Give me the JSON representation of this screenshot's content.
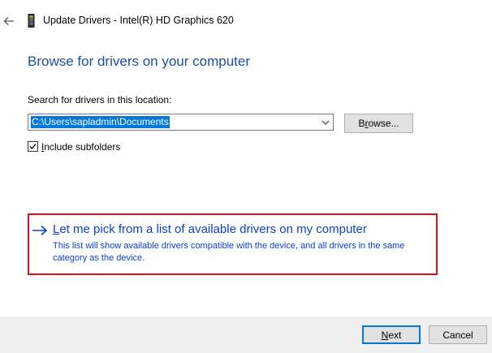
{
  "window": {
    "title": "Update Drivers - Intel(R) HD Graphics 620"
  },
  "page": {
    "heading": "Browse for drivers on your computer",
    "search_label": "Search for drivers in this location:",
    "path_value": "C:\\Users\\sapladmin\\Documents",
    "browse_label_pre": "B",
    "browse_label_accel": "r",
    "browse_label_post": "owse...",
    "include_subfolders_accel": "I",
    "include_subfolders_rest": "nclude subfolders",
    "include_subfolders_checked": true
  },
  "pick_option": {
    "title_accel": "L",
    "title_rest": "et me pick from a list of available drivers on my computer",
    "description": "This list will show available drivers compatible with the device, and all drivers in the same category as the device."
  },
  "footer": {
    "next_accel": "N",
    "next_rest": "ext",
    "cancel_label": "Cancel"
  },
  "colors": {
    "heading": "#1a4fa0",
    "link": "#0a3fd1",
    "highlight_box": "#e0101a",
    "selection": "#0078d7",
    "footer_bg": "#f0f0f0"
  },
  "icons": {
    "back": "back-arrow-icon",
    "device": "graphics-card-icon",
    "dropdown": "chevron-down-icon",
    "check": "checkmark-icon",
    "link_arrow": "arrow-right-icon"
  }
}
